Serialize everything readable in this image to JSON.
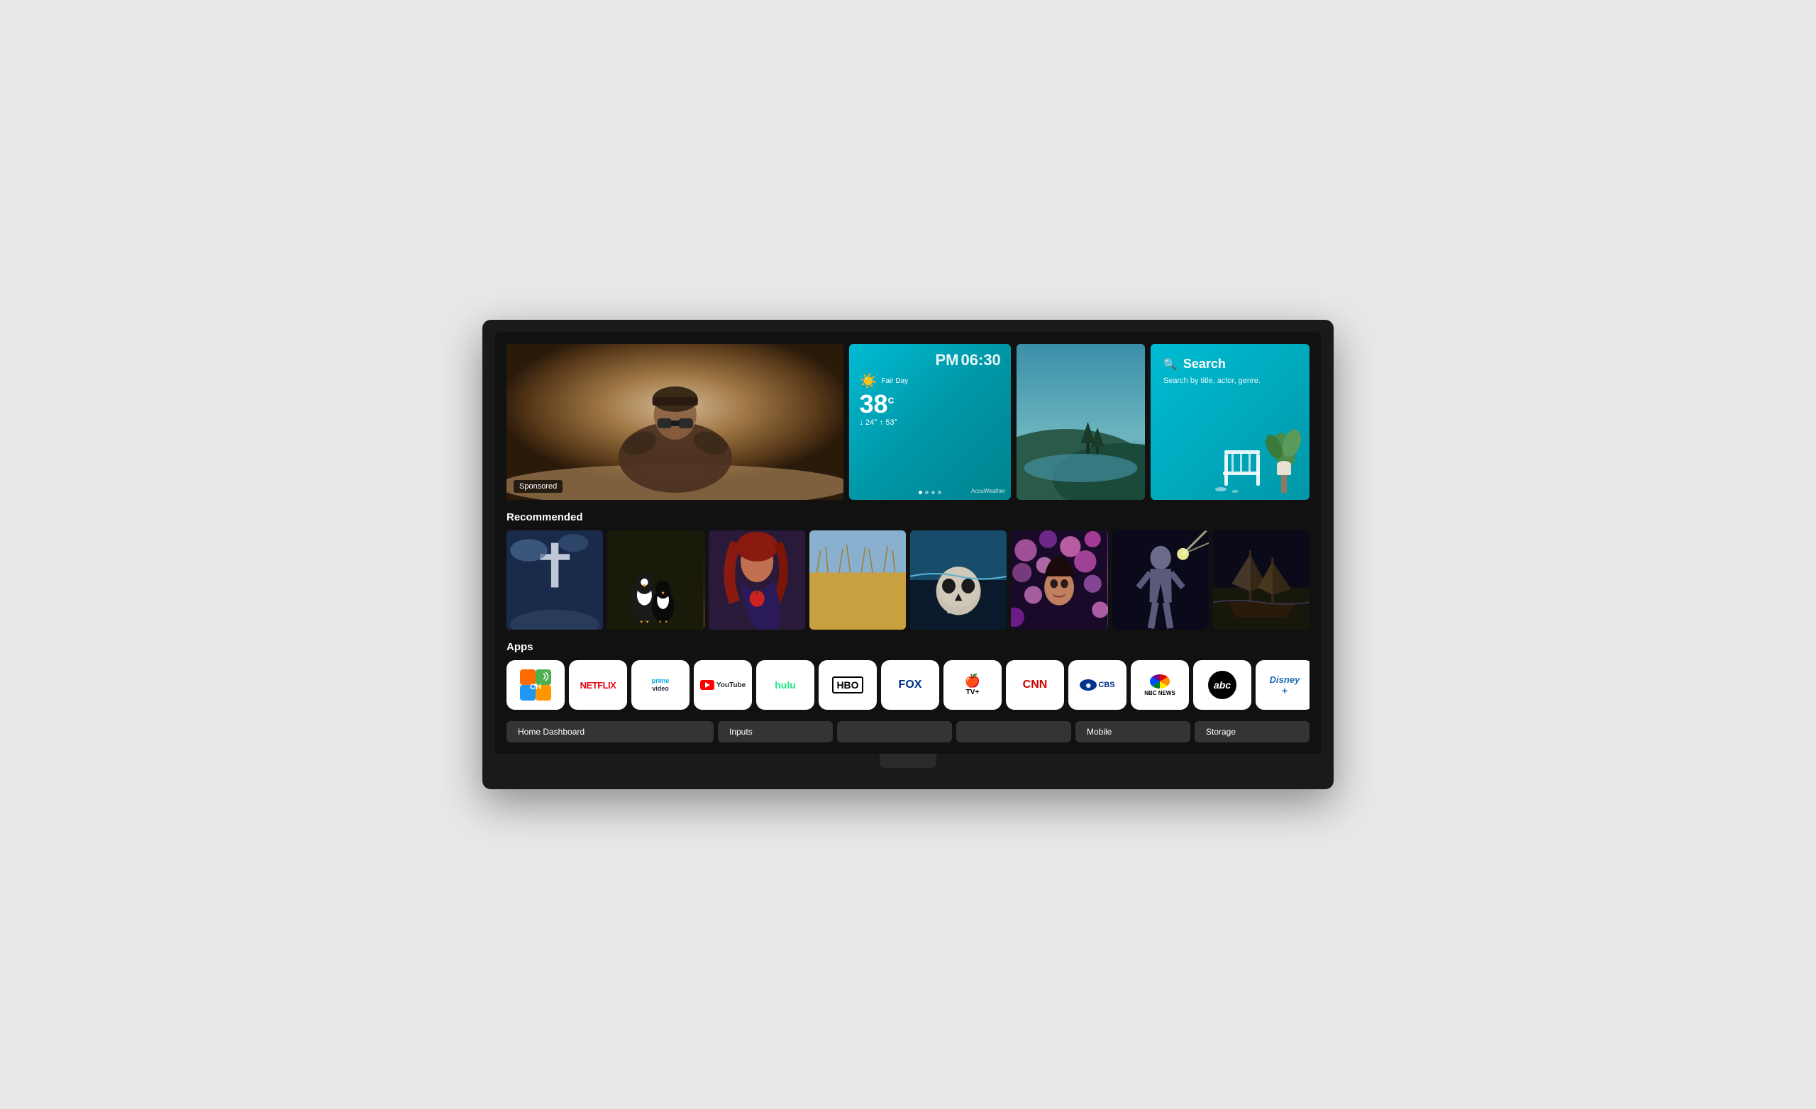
{
  "tv": {
    "hero": {
      "sponsored_label": "Sponsored",
      "weather": {
        "time_period": "PM",
        "time": "06:30",
        "condition": "Fair Day",
        "temp": "38",
        "temp_unit": "c",
        "low": "24°",
        "high": "53°",
        "brand": "AccuWeather"
      },
      "search": {
        "icon": "🔍",
        "title": "Search",
        "subtitle": "Search by title, actor, genre."
      }
    },
    "sections": {
      "recommended": {
        "title": "Recommended",
        "items": [
          {
            "id": 1,
            "alt": "Cross monument blue sky"
          },
          {
            "id": 2,
            "alt": "Penguins"
          },
          {
            "id": 3,
            "alt": "Red haired woman with apple"
          },
          {
            "id": 4,
            "alt": "Wheat field"
          },
          {
            "id": 5,
            "alt": "Underwater skull"
          },
          {
            "id": 6,
            "alt": "Woman with flowers"
          },
          {
            "id": 7,
            "alt": "Soccer player silhouette"
          },
          {
            "id": 8,
            "alt": "Pirate ship"
          }
        ]
      },
      "apps": {
        "title": "Apps",
        "items": [
          {
            "id": "ch",
            "label": "CH"
          },
          {
            "id": "netflix",
            "label": "NETFLIX"
          },
          {
            "id": "prime",
            "label": "prime video"
          },
          {
            "id": "youtube",
            "label": "YouTube"
          },
          {
            "id": "hulu",
            "label": "hulu"
          },
          {
            "id": "hbo",
            "label": "HBO"
          },
          {
            "id": "fox",
            "label": "FOX"
          },
          {
            "id": "appletv",
            "label": "Apple TV+"
          },
          {
            "id": "cnn",
            "label": "CNN"
          },
          {
            "id": "cbs",
            "label": "CBS"
          },
          {
            "id": "nbc",
            "label": "NBC NEWS"
          },
          {
            "id": "abc",
            "label": "abc"
          },
          {
            "id": "disney",
            "label": "Disney+"
          }
        ]
      },
      "bottom_tabs": [
        {
          "id": "home",
          "label": "Home Dashboard",
          "wide": true
        },
        {
          "id": "inputs",
          "label": "Inputs",
          "wide": false
        },
        {
          "id": "tab3",
          "label": "",
          "wide": false
        },
        {
          "id": "tab4",
          "label": "",
          "wide": false
        },
        {
          "id": "mobile",
          "label": "Mobile",
          "wide": false
        },
        {
          "id": "storage",
          "label": "Storage",
          "wide": false
        }
      ]
    }
  }
}
